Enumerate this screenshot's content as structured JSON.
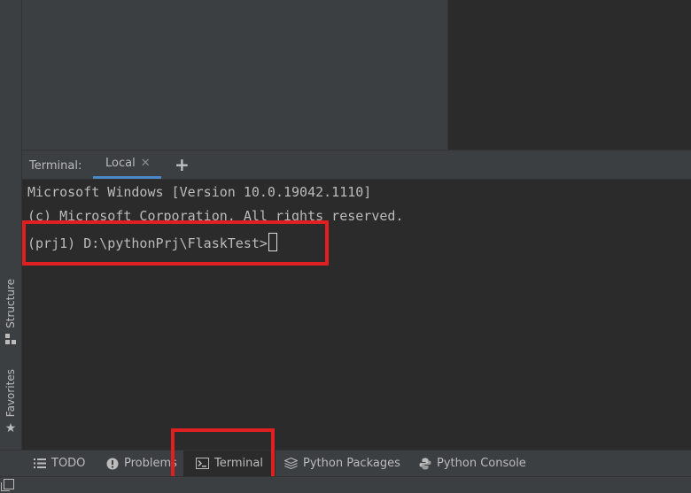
{
  "side_strip": {
    "structure_label": "Structure",
    "favorites_label": "Favorites"
  },
  "terminal": {
    "title": "Terminal:",
    "tabs": [
      {
        "label": "Local"
      }
    ],
    "lines": [
      "Microsoft Windows [Version 10.0.19042.1110]",
      "(c) Microsoft Corporation. All rights reserved.",
      "(prj1) D:\\pythonPrj\\FlaskTest>"
    ]
  },
  "bottom_tabs": [
    {
      "label": "TODO",
      "icon": "list-icon"
    },
    {
      "label": "Problems",
      "icon": "problems-icon"
    },
    {
      "label": "Terminal",
      "icon": "terminal-icon",
      "active": true
    },
    {
      "label": "Python Packages",
      "icon": "layers-icon"
    },
    {
      "label": "Python Console",
      "icon": "python-icon"
    }
  ],
  "colors": {
    "highlight": "#e02020",
    "tab_underline": "#4a88c7",
    "panel_bg": "#3c3f41",
    "terminal_bg": "#2b2b2b"
  }
}
